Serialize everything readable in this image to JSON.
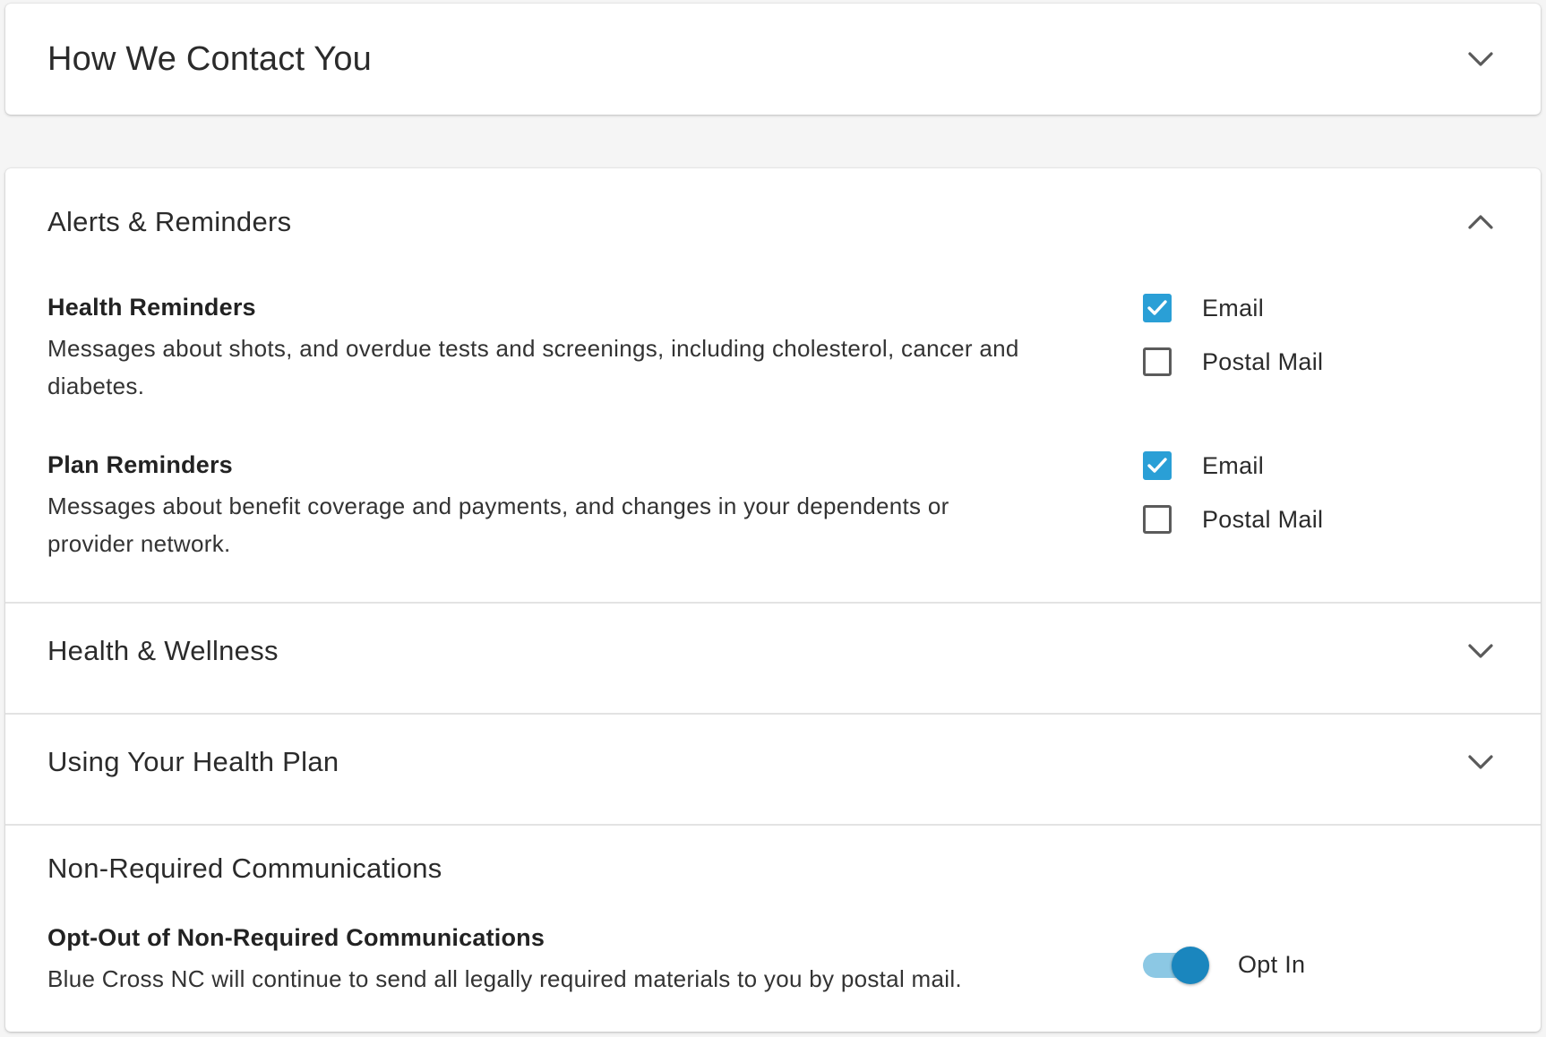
{
  "colors": {
    "accent": "#2a9fd6",
    "toggle_knob": "#1a86be",
    "toggle_track": "#8cc8e4",
    "page_bg": "#f5f5f5",
    "card_bg": "#ffffff"
  },
  "contact_section": {
    "title": "How We Contact You",
    "icon": "chevron-down-icon"
  },
  "alerts_section": {
    "title": "Alerts & Reminders",
    "icon": "chevron-up-icon",
    "items": [
      {
        "title": "Health Reminders",
        "description": "Messages about shots, and overdue tests and screenings, including cholesterol, cancer and diabetes.",
        "options": [
          {
            "label": "Email",
            "checked": true
          },
          {
            "label": "Postal Mail",
            "checked": false
          }
        ]
      },
      {
        "title": "Plan Reminders",
        "description": "Messages about benefit coverage and payments, and changes in your dependents or provider network.",
        "options": [
          {
            "label": "Email",
            "checked": true
          },
          {
            "label": "Postal Mail",
            "checked": false
          }
        ]
      }
    ]
  },
  "wellness_section": {
    "title": "Health & Wellness",
    "icon": "chevron-down-icon"
  },
  "plan_section": {
    "title": "Using Your Health Plan",
    "icon": "chevron-down-icon"
  },
  "nonrequired_section": {
    "title": "Non-Required Communications",
    "item": {
      "title": "Opt-Out of Non-Required Communications",
      "description": "Blue Cross NC will continue to send all legally required materials to you by postal mail.",
      "toggle_label": "Opt In",
      "toggle_on": true
    }
  }
}
